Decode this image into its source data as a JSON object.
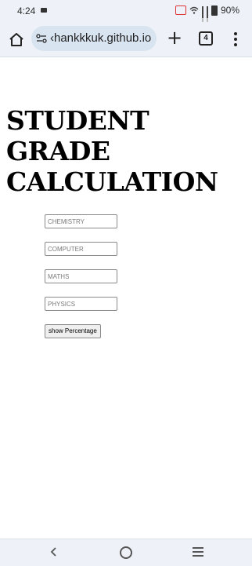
{
  "status_bar": {
    "time": "4:24",
    "battery": "90%"
  },
  "browser": {
    "url": "‹hankkkuk.github.io",
    "tab_count": "4"
  },
  "page": {
    "title": "STUDENT GRADE CALCULATION",
    "inputs": [
      {
        "placeholder": "CHEMISTRY",
        "value": ""
      },
      {
        "placeholder": "COMPUTER",
        "value": ""
      },
      {
        "placeholder": "MATHS",
        "value": ""
      },
      {
        "placeholder": "PHYSICS",
        "value": ""
      }
    ],
    "button_label": "show Percentage"
  },
  "icons": {
    "home": "home-icon",
    "site_settings": "site-settings-icon",
    "new_tab": "plus-icon",
    "tabs": "tab-switcher-icon",
    "menu": "more-vert-icon",
    "nav_back": "back-icon",
    "nav_home": "circle-home-icon",
    "nav_recents": "recents-icon"
  },
  "colors": {
    "chrome_bg": "#eef2f8",
    "url_bar_bg": "#d9e4f1",
    "cast_red": "#dd3333"
  }
}
